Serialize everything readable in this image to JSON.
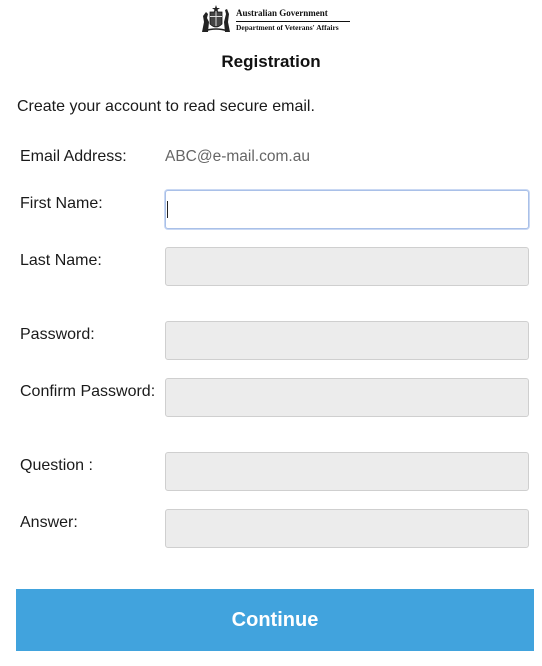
{
  "header": {
    "logo_line1": "Australian Government",
    "logo_line2": "Department of Veterans' Affairs",
    "title": "Registration"
  },
  "intro_text": "Create your account to read secure email.",
  "form": {
    "email_label": "Email Address:",
    "email_value": "ABC@e-mail.com.au",
    "first_name_label": "First Name:",
    "first_name_value": "",
    "last_name_label": "Last Name:",
    "last_name_value": "",
    "password_label": "Password:",
    "password_value": "",
    "confirm_password_label": "Confirm Password:",
    "confirm_password_value": "",
    "question_label": "Question :",
    "question_value": "",
    "answer_label": "Answer:",
    "answer_value": ""
  },
  "actions": {
    "continue_label": "Continue"
  },
  "colors": {
    "accent": "#41a3dd",
    "field_background": "#ececec",
    "focus_border": "#a9c0e8"
  }
}
